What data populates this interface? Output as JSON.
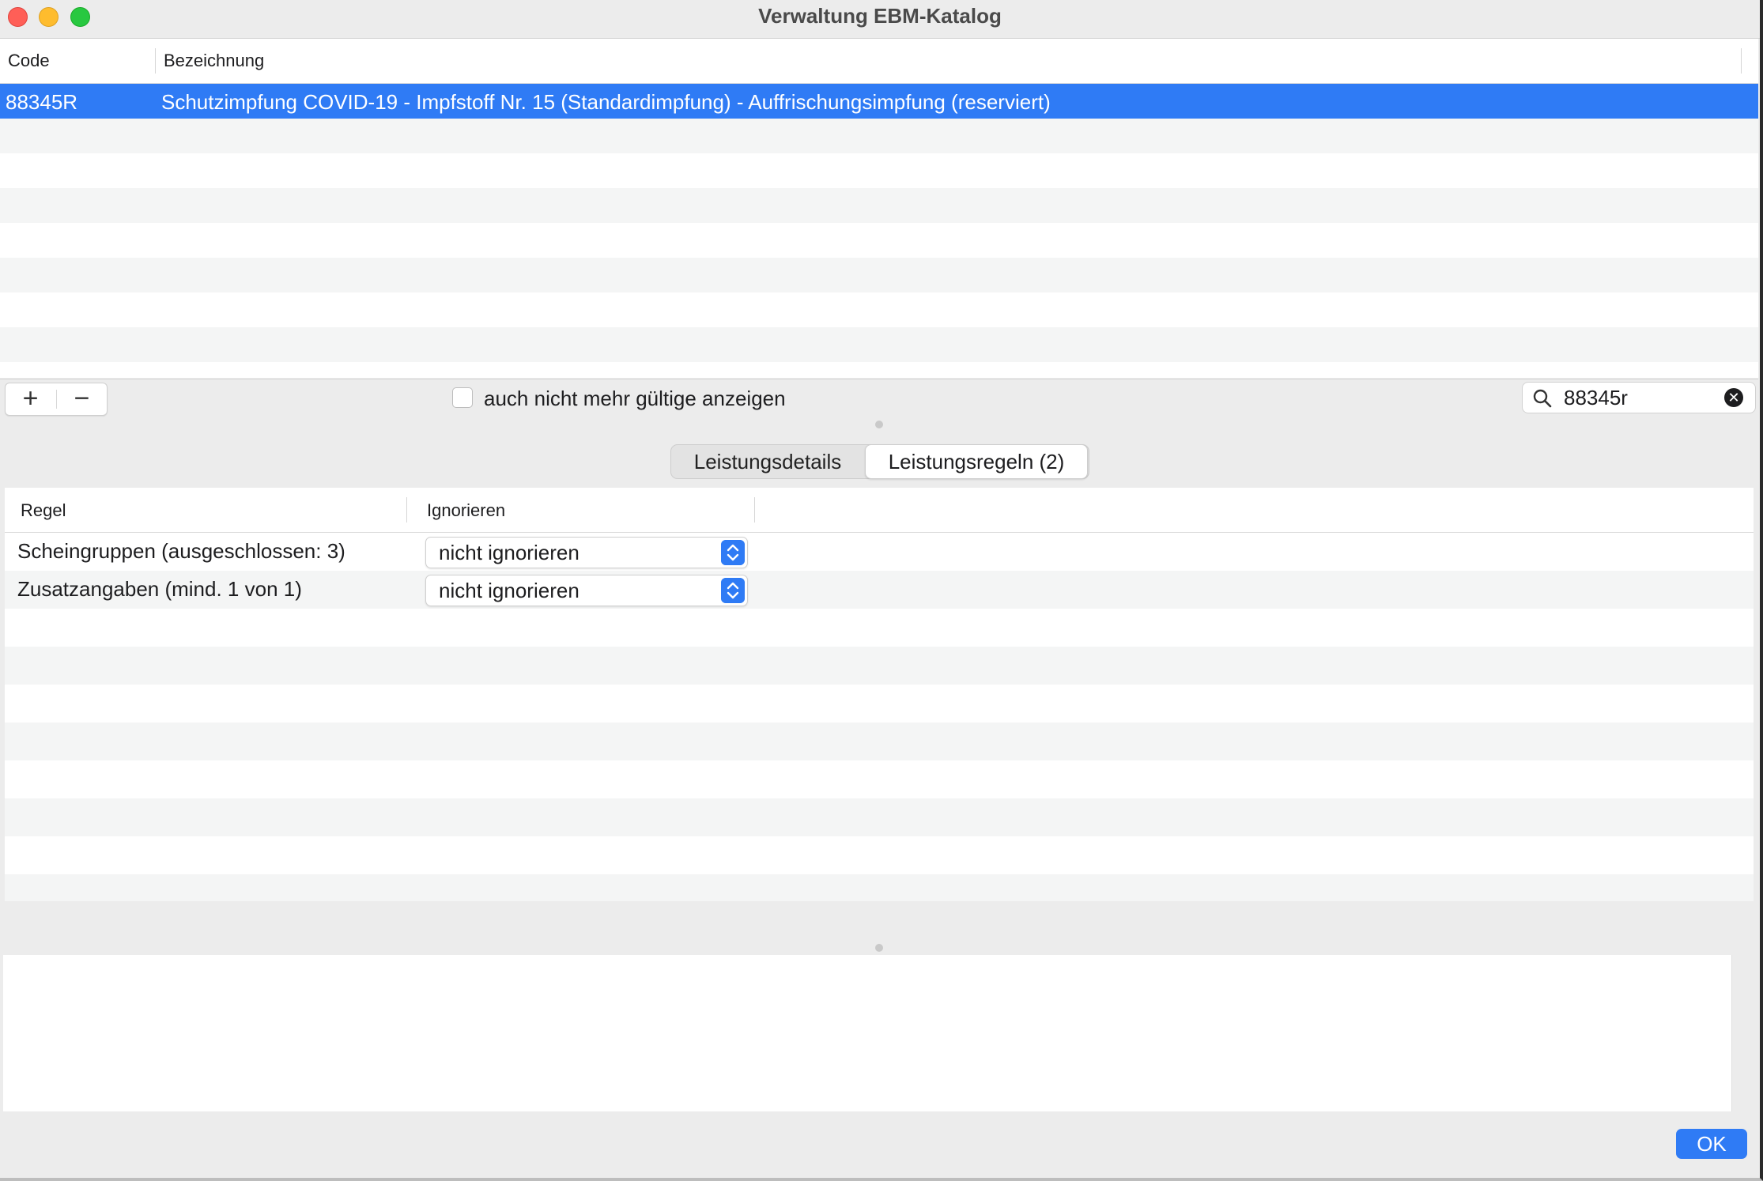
{
  "window": {
    "title": "Verwaltung EBM-Katalog"
  },
  "catalog_table": {
    "columns": [
      "Code",
      "Bezeichnung"
    ],
    "rows": [
      {
        "code": "88345R",
        "bezeichnung": "Schutzimpfung COVID-19 - Impfstoff Nr. 15 (Standardimpfung) - Auffrischungsimpfung (reserviert)",
        "selected": true
      }
    ]
  },
  "toolbar": {
    "add_label": "+",
    "remove_label": "−",
    "show_invalid_label": "auch nicht mehr gültige anzeigen",
    "show_invalid_checked": false,
    "search_value": "88345r",
    "search_clear_label": "✕"
  },
  "tabs": [
    {
      "label": "Leistungsdetails",
      "selected": false
    },
    {
      "label": "Leistungsregeln (2)",
      "selected": true
    }
  ],
  "rules_table": {
    "columns": [
      "Regel",
      "Ignorieren"
    ],
    "rows": [
      {
        "regel": "Scheingruppen (ausgeschlossen: 3)",
        "ignorieren": "nicht ignorieren"
      },
      {
        "regel": "Zusatzangaben (mind. 1 von 1)",
        "ignorieren": "nicht ignorieren"
      }
    ]
  },
  "footer": {
    "ok_label": "OK"
  },
  "colors": {
    "accent": "#2f7bf5",
    "close": "#ff5f57",
    "minimize": "#febc2e",
    "maximize": "#28c840"
  }
}
